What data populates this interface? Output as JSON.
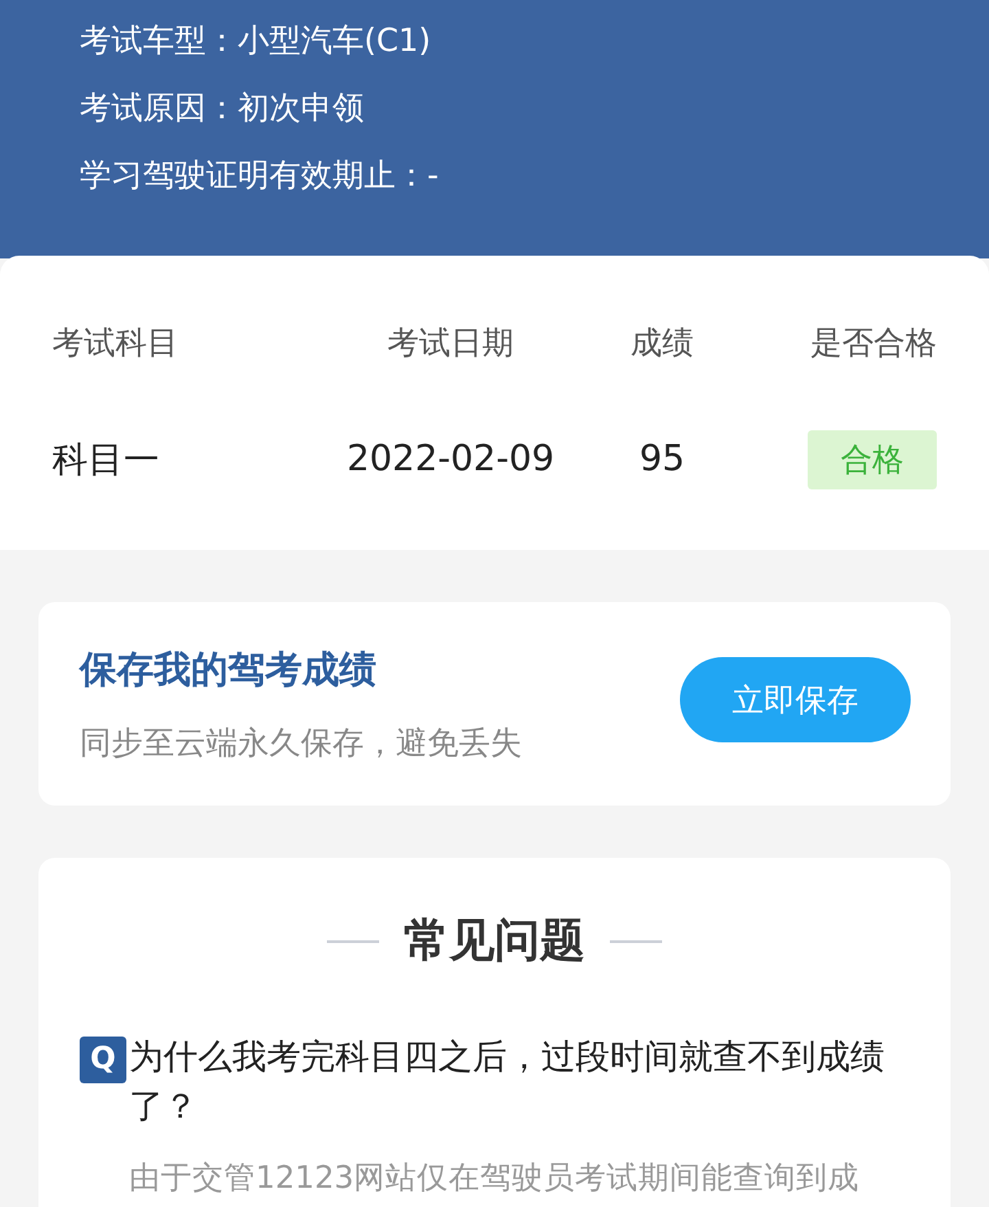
{
  "exam_info": [
    {
      "label": "考试车型：",
      "value": "小型汽车(C1)"
    },
    {
      "label": "考试原因：",
      "value": "初次申领"
    },
    {
      "label": "学习驾驶证明有效期止：",
      "value": "-"
    }
  ],
  "results_table": {
    "columns": [
      "考试科目",
      "考试日期",
      "成绩",
      "是否合格"
    ],
    "rows": [
      {
        "subject": "科目一",
        "date": "2022-02-09",
        "score": "95",
        "result": "合格",
        "passed": true
      }
    ]
  },
  "save_card": {
    "title": "保存我的驾考成绩",
    "subtitle": "同步至云端永久保存，避免丢失",
    "button": "立即保存"
  },
  "faq": {
    "title": "常见问题",
    "items": [
      {
        "badge": "Q",
        "question": "为什么我考完科目四之后，过段时间就查不到成绩了？",
        "answer": "由于交管12123网站仅在驾驶员考试期间能查询到成"
      }
    ]
  }
}
